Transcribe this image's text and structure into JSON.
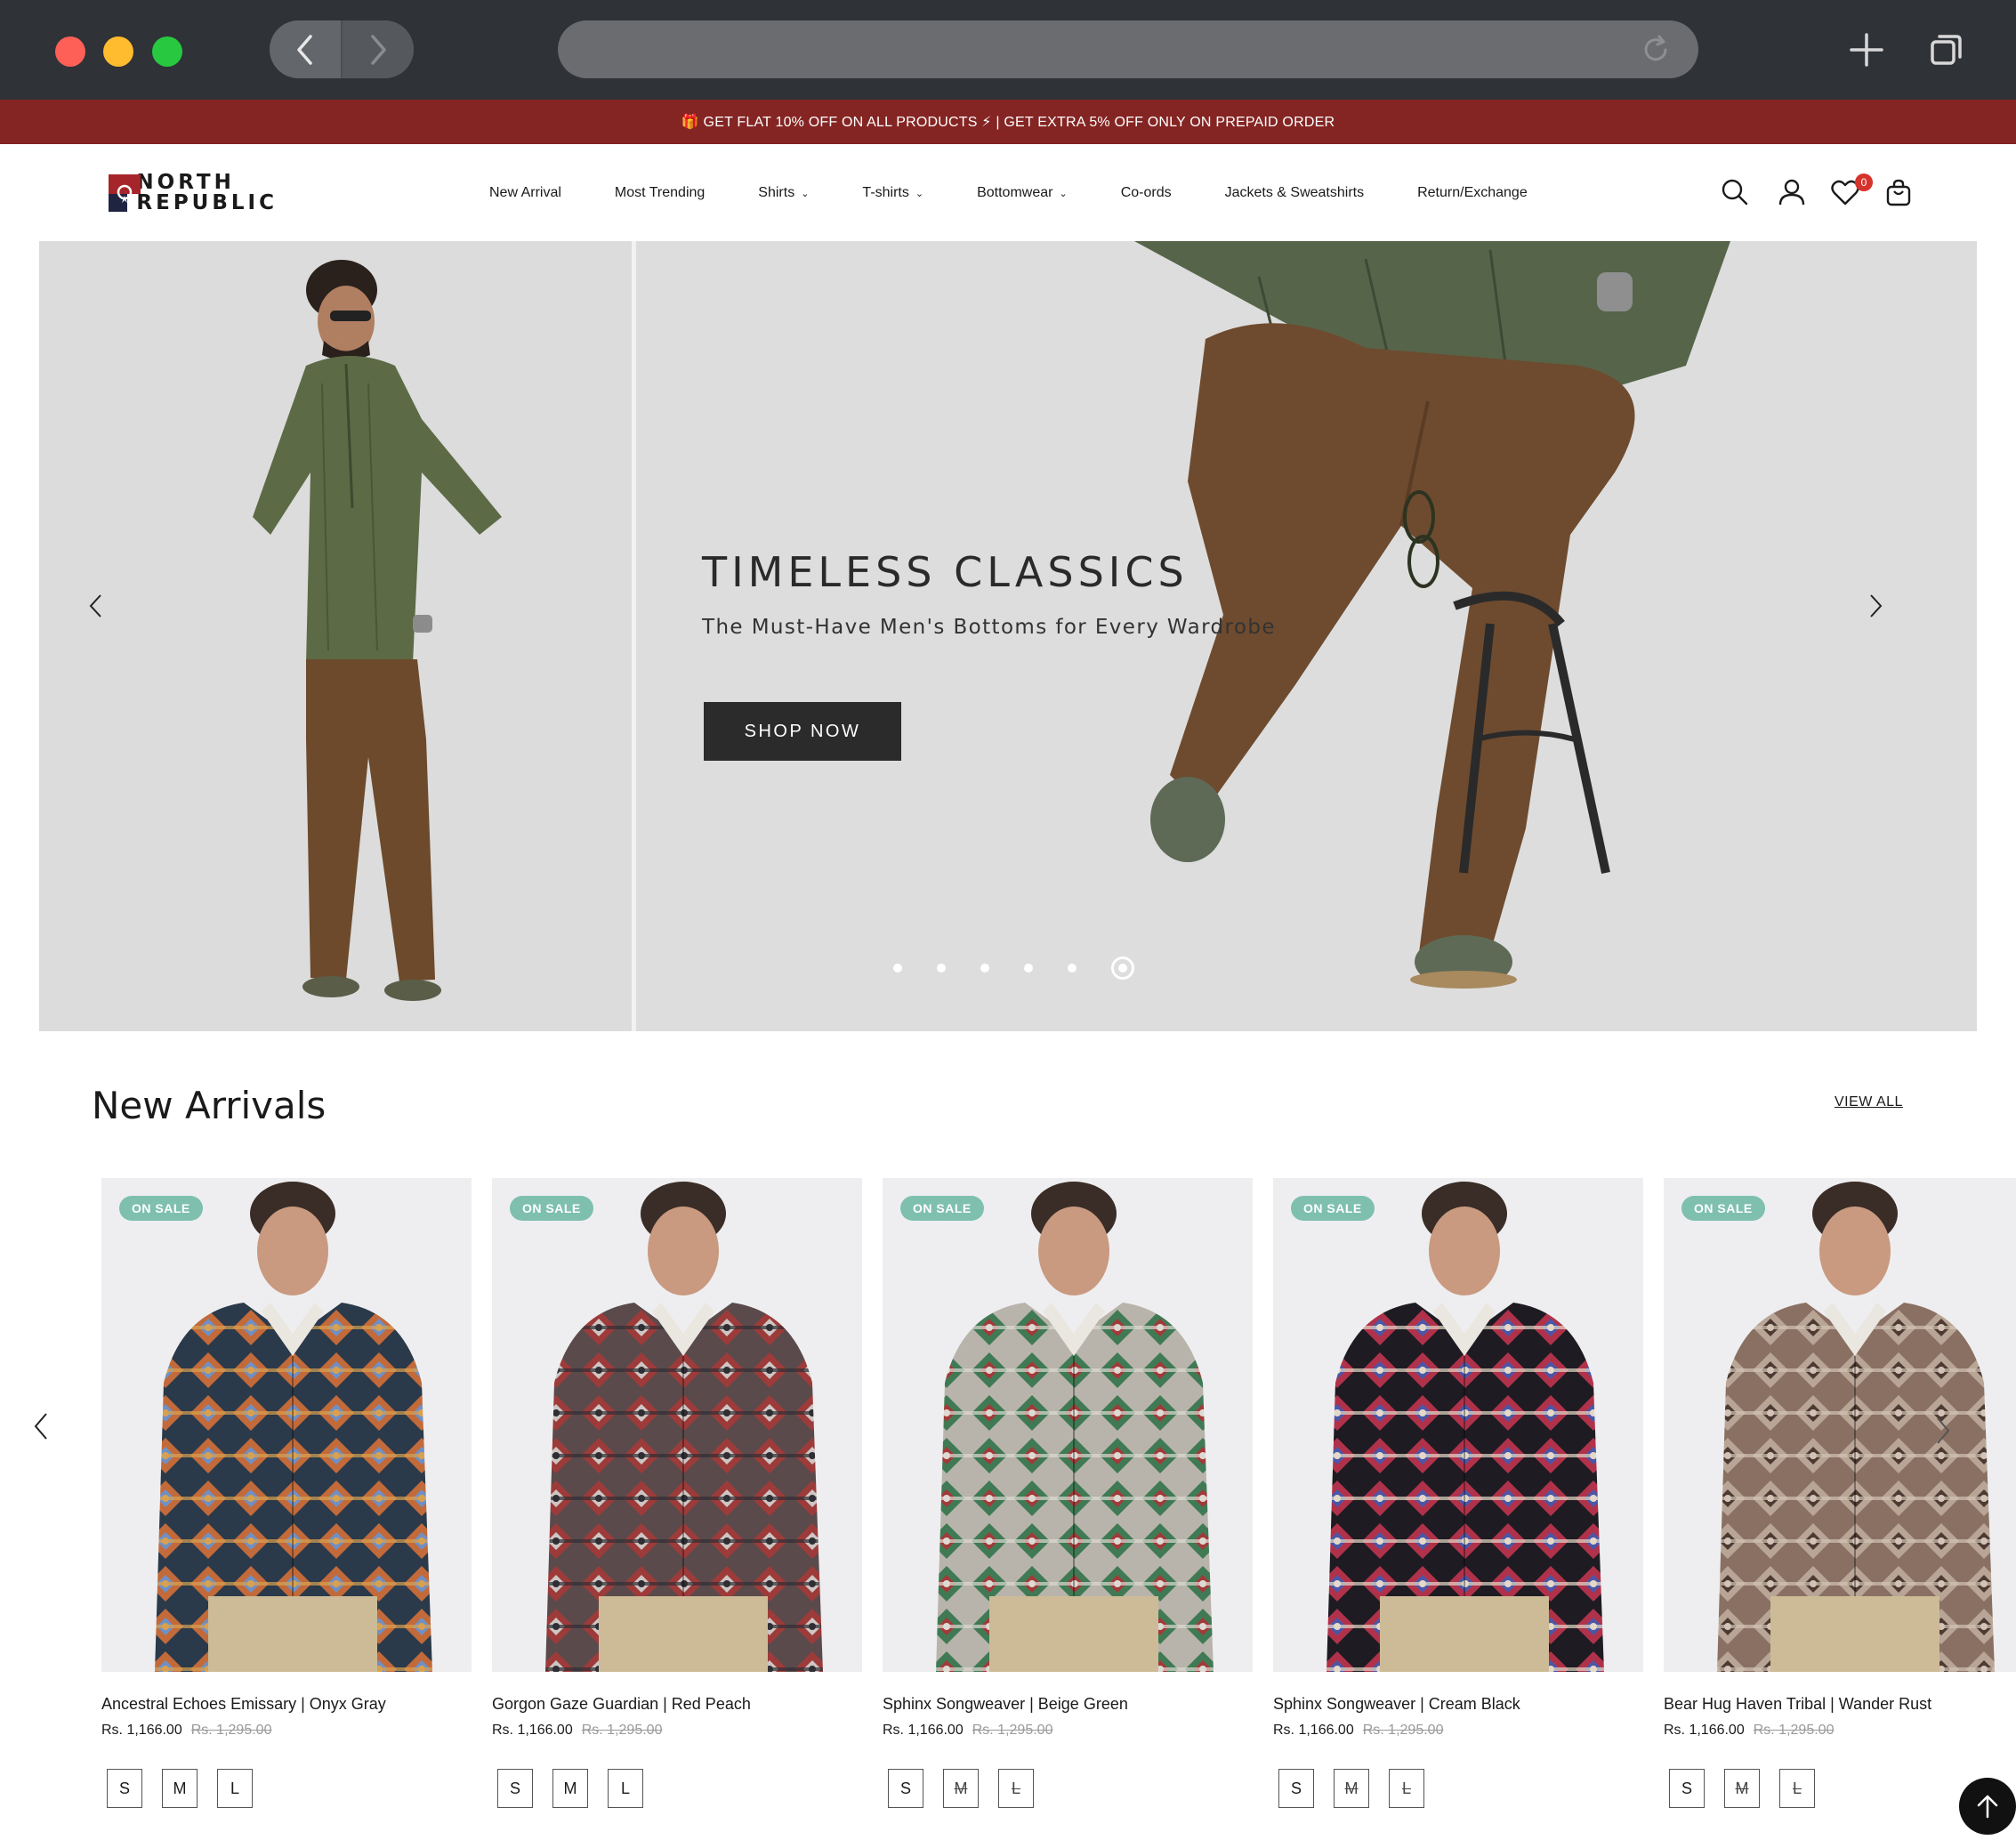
{
  "announcement": "🎁 GET FLAT 10% OFF ON ALL PRODUCTS ⚡ | GET EXTRA 5% OFF ONLY ON PREPAID ORDER",
  "brand": {
    "line1": "NORTH",
    "line2": "REPUBLIC",
    "logo_icon": "north-republic-logo"
  },
  "nav": [
    {
      "label": "New Arrival",
      "dropdown": false
    },
    {
      "label": "Most Trending",
      "dropdown": false
    },
    {
      "label": "Shirts",
      "dropdown": true
    },
    {
      "label": "T-shirts",
      "dropdown": true
    },
    {
      "label": "Bottomwear",
      "dropdown": true
    },
    {
      "label": "Co-ords",
      "dropdown": false
    },
    {
      "label": "Jackets & Sweatshirts",
      "dropdown": false
    },
    {
      "label": "Return/Exchange",
      "dropdown": false
    }
  ],
  "header_icons": {
    "wishlist_count": "0"
  },
  "hero": {
    "title": "TIMELESS CLASSICS",
    "subtitle": "The Must-Have Men's Bottoms for Every Wardrobe",
    "cta": "SHOP NOW",
    "slide_count": 6,
    "active_slide": 6
  },
  "new_arrivals": {
    "title": "New Arrivals",
    "view_all": "VIEW ALL",
    "products": [
      {
        "badge": "ON SALE",
        "name": "Ancestral Echoes Emissary | Onyx Gray",
        "price": "Rs. 1,166.00",
        "old_price": "Rs. 1,295.00",
        "sizes": [
          "S",
          "M",
          "L"
        ],
        "sold_out_sizes": [],
        "shirt_colors": [
          "#2b3a4a",
          "#c26a3a",
          "#6f8fc7",
          "#d9a24f"
        ]
      },
      {
        "badge": "ON SALE",
        "name": "Gorgon Gaze Guardian | Red Peach",
        "price": "Rs. 1,166.00",
        "old_price": "Rs. 1,295.00",
        "sizes": [
          "S",
          "M",
          "L"
        ],
        "sold_out_sizes": [],
        "shirt_colors": [
          "#5b4a4c",
          "#9c3b3a",
          "#cfc6c4",
          "#2e2e33"
        ]
      },
      {
        "badge": "ON SALE",
        "name": "Sphinx Songweaver | Beige Green",
        "price": "Rs. 1,166.00",
        "old_price": "Rs. 1,295.00",
        "sizes": [
          "S",
          "M",
          "L"
        ],
        "sold_out_sizes": [
          "M",
          "L"
        ],
        "shirt_colors": [
          "#b8b4ab",
          "#3f7a54",
          "#a33a3a",
          "#dddad3"
        ]
      },
      {
        "badge": "ON SALE",
        "name": "Sphinx Songweaver | Cream Black",
        "price": "Rs. 1,166.00",
        "old_price": "Rs. 1,295.00",
        "sizes": [
          "S",
          "M",
          "L"
        ],
        "sold_out_sizes": [
          "M",
          "L"
        ],
        "shirt_colors": [
          "#1e1b22",
          "#b0324a",
          "#4a57a8",
          "#e4d9c8"
        ]
      },
      {
        "badge": "ON SALE",
        "name": "Bear Hug Haven Tribal | Wander Rust",
        "price": "Rs. 1,166.00",
        "old_price": "Rs. 1,295.00",
        "sizes": [
          "S",
          "M",
          "L"
        ],
        "sold_out_sizes": [
          "M",
          "L"
        ],
        "shirt_colors": [
          "#8a7062",
          "#b9a596",
          "#4c3a33",
          "#d2c3b6"
        ]
      }
    ]
  },
  "colors": {
    "announcement_bg": "#842523",
    "sale_badge": "#7fbfae",
    "cta_bg": "#2b2b2b"
  }
}
